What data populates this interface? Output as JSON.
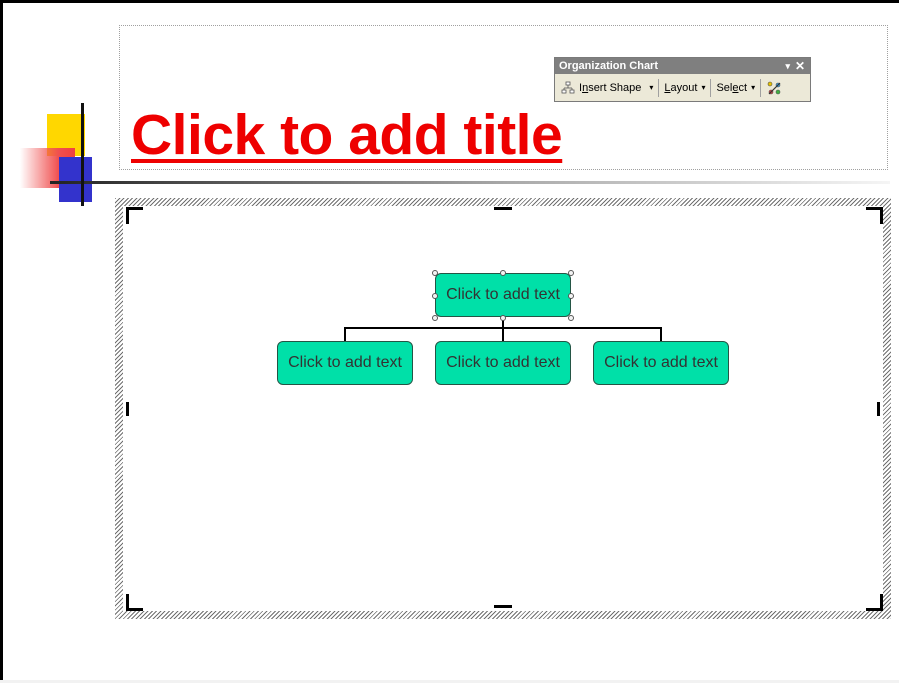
{
  "slide": {
    "title_placeholder": "Click to add title"
  },
  "org_toolbar": {
    "title": "Organization Chart",
    "dropdown_icon": "▾",
    "close_icon": "✕",
    "insert_shape": {
      "pre": "I",
      "ul": "n",
      "post": "sert Shape"
    },
    "layout": {
      "pre": "",
      "ul": "L",
      "post": "ayout"
    },
    "select": {
      "pre": "Sel",
      "ul": "e",
      "post": "ct"
    },
    "arrow": "▾"
  },
  "org_chart": {
    "top_box": "Click to add text",
    "children": [
      "Click to add text",
      "Click to add text",
      "Click to add text"
    ]
  },
  "colors": {
    "title": "#ee0000",
    "box_fill": "#00e0a8",
    "toolbar_title_bar": "#7f7f7f"
  }
}
